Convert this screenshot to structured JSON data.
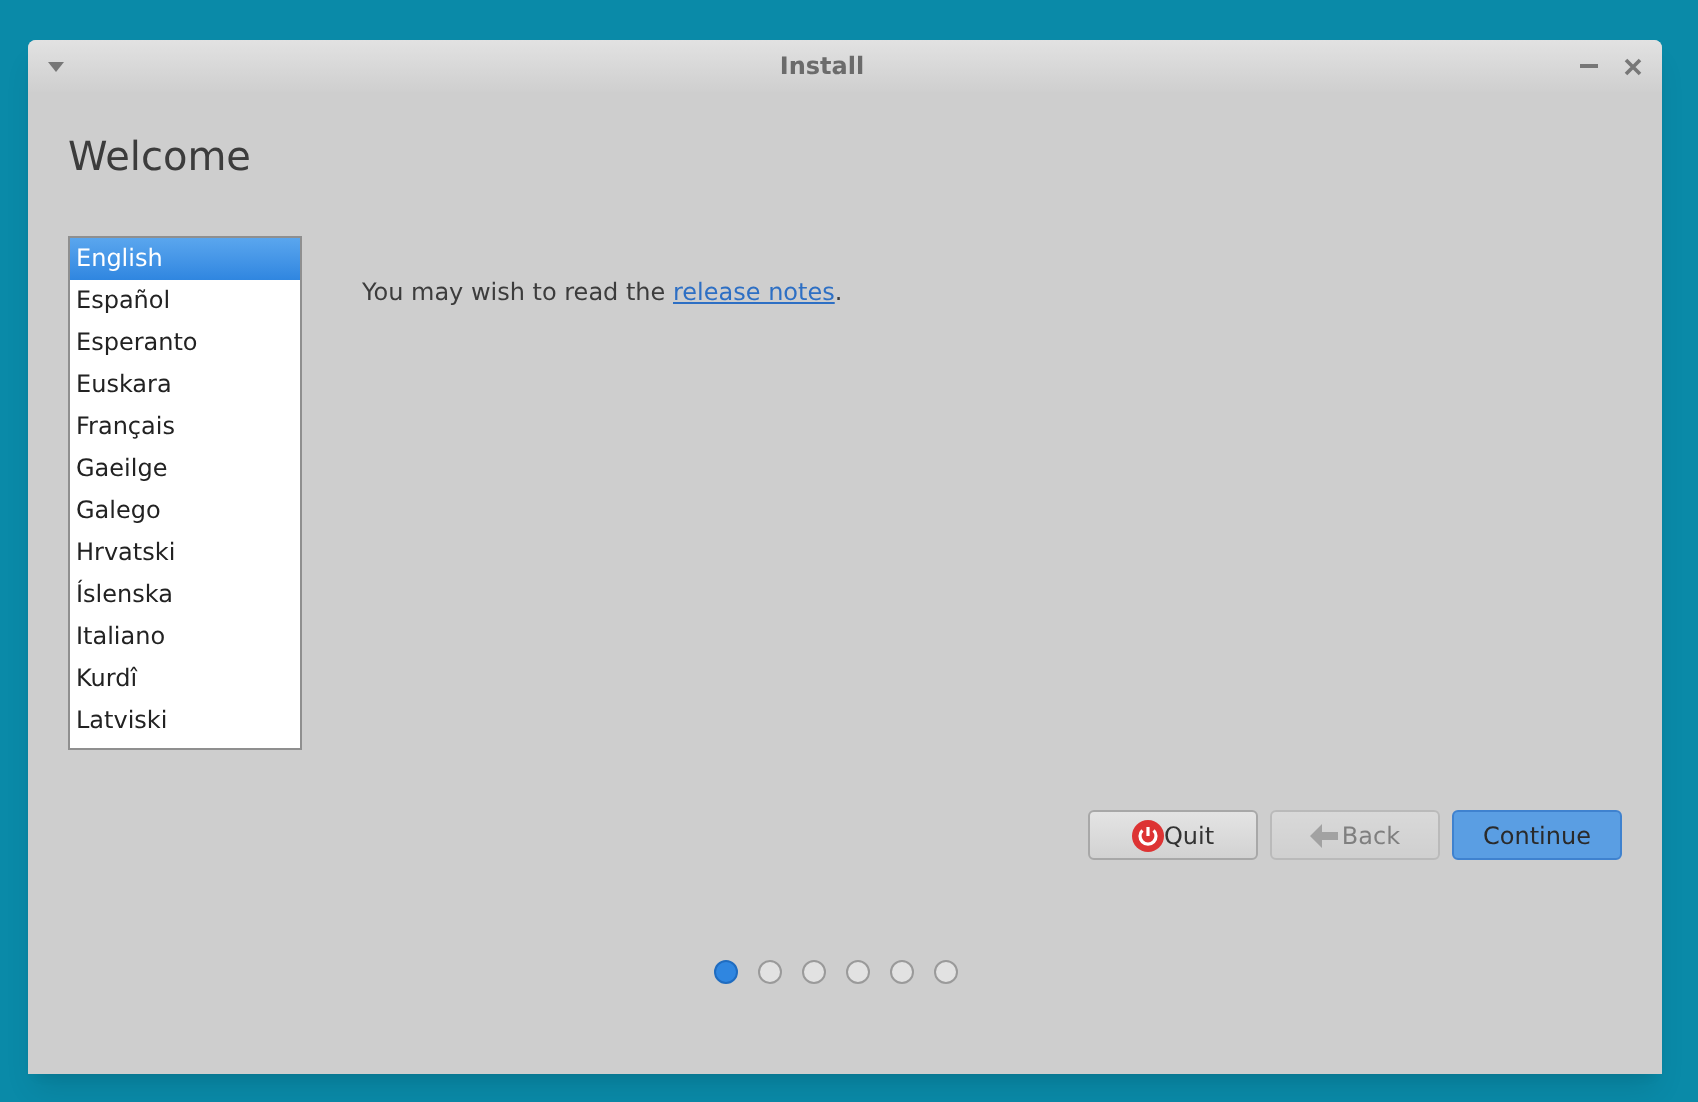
{
  "window": {
    "title": "Install"
  },
  "heading": "Welcome",
  "languages": [
    {
      "label": "English",
      "selected": true
    },
    {
      "label": "Español",
      "selected": false
    },
    {
      "label": "Esperanto",
      "selected": false
    },
    {
      "label": "Euskara",
      "selected": false
    },
    {
      "label": "Français",
      "selected": false
    },
    {
      "label": "Gaeilge",
      "selected": false
    },
    {
      "label": "Galego",
      "selected": false
    },
    {
      "label": "Hrvatski",
      "selected": false
    },
    {
      "label": "Íslenska",
      "selected": false
    },
    {
      "label": "Italiano",
      "selected": false
    },
    {
      "label": "Kurdî",
      "selected": false
    },
    {
      "label": "Latviski",
      "selected": false
    }
  ],
  "notes": {
    "text": "You may wish to read the",
    "link": "release notes",
    "end": "."
  },
  "buttons": [
    {
      "label": "Quit",
      "kind": "quit",
      "disabled": false
    },
    {
      "label": "Back",
      "kind": "back",
      "disabled": true
    },
    {
      "label": "Continue",
      "kind": "continue",
      "disabled": false
    }
  ],
  "steps": [
    {
      "selected": true
    },
    {
      "selected": false
    },
    {
      "selected": false
    },
    {
      "selected": false
    },
    {
      "selected": false
    },
    {
      "selected": false
    }
  ]
}
